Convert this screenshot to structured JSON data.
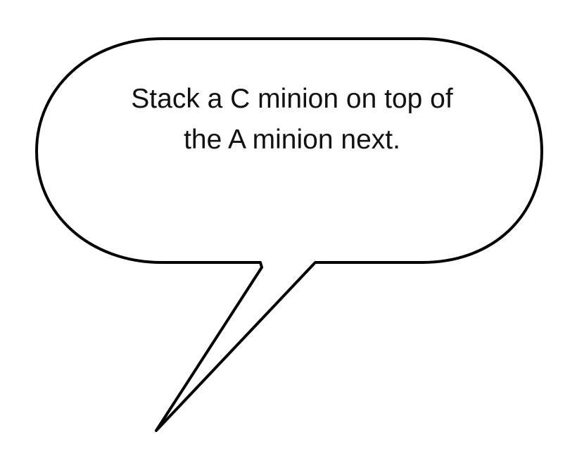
{
  "speech_bubble": {
    "lines": [
      "Stack a C minion on top of",
      "the A minion next."
    ],
    "fill_color": "#ffffff",
    "stroke_color": "#000000",
    "text_color": "#111111"
  }
}
